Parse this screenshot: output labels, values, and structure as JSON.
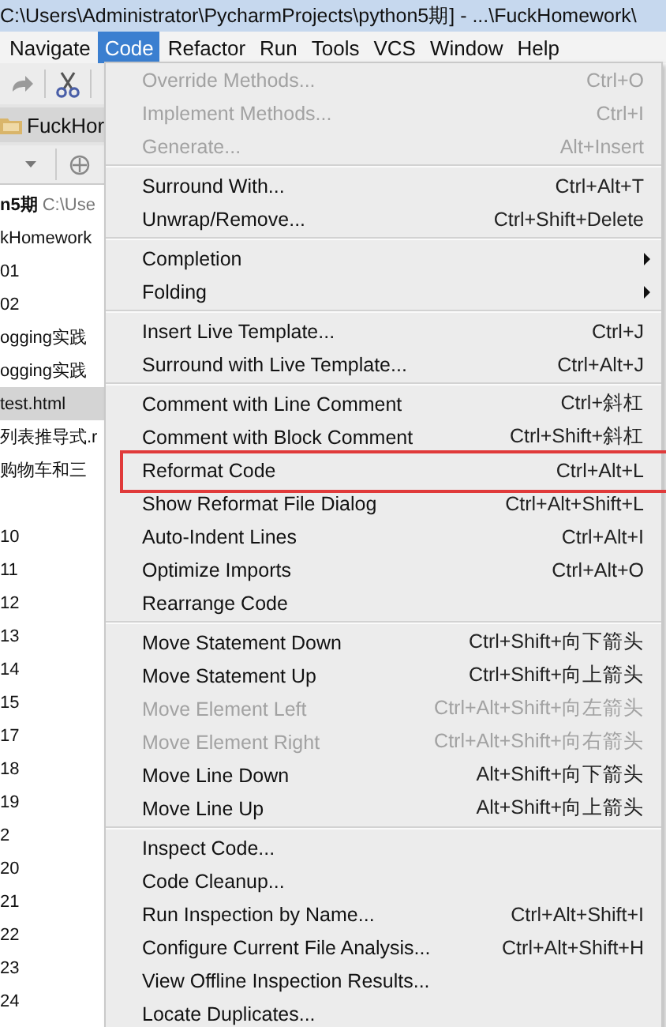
{
  "window": {
    "title": "C:\\Users\\Administrator\\PycharmProjects\\python5期] - ...\\FuckHomework\\"
  },
  "menu_bar": [
    {
      "label": "Navigate",
      "selected": false
    },
    {
      "label": "Code",
      "selected": true
    },
    {
      "label": "Refactor",
      "selected": false
    },
    {
      "label": "Run",
      "selected": false
    },
    {
      "label": "Tools",
      "selected": false
    },
    {
      "label": "VCS",
      "selected": false
    },
    {
      "label": "Window",
      "selected": false
    },
    {
      "label": "Help",
      "selected": false
    }
  ],
  "project_tab": {
    "label": "FuckHor"
  },
  "tree": [
    {
      "kind": "root",
      "label": "n5期",
      "note": "C:\\Use",
      "selected": false
    },
    {
      "kind": "file",
      "label": "kHomework",
      "selected": false
    },
    {
      "kind": "file",
      "label": "01",
      "selected": false
    },
    {
      "kind": "file",
      "label": "02",
      "selected": false
    },
    {
      "kind": "file",
      "label": "ogging实践",
      "selected": false
    },
    {
      "kind": "file",
      "label": "ogging实践",
      "selected": false
    },
    {
      "kind": "file",
      "label": "test.html",
      "selected": true
    },
    {
      "kind": "file",
      "label": "列表推导式.r",
      "selected": false
    },
    {
      "kind": "file",
      "label": "购物车和三",
      "selected": false
    },
    {
      "kind": "spacer"
    },
    {
      "kind": "file",
      "label": "10",
      "selected": false
    },
    {
      "kind": "file",
      "label": "11",
      "selected": false
    },
    {
      "kind": "file",
      "label": "12",
      "selected": false
    },
    {
      "kind": "file",
      "label": "13",
      "selected": false
    },
    {
      "kind": "file",
      "label": "14",
      "selected": false
    },
    {
      "kind": "file",
      "label": "15",
      "selected": false
    },
    {
      "kind": "file",
      "label": "17",
      "selected": false
    },
    {
      "kind": "file",
      "label": "18",
      "selected": false
    },
    {
      "kind": "file",
      "label": "19",
      "selected": false
    },
    {
      "kind": "file",
      "label": "2",
      "selected": false
    },
    {
      "kind": "file",
      "label": "20",
      "selected": false
    },
    {
      "kind": "file",
      "label": "21",
      "selected": false
    },
    {
      "kind": "file",
      "label": "22",
      "selected": false
    },
    {
      "kind": "file",
      "label": "23",
      "selected": false
    },
    {
      "kind": "file",
      "label": "24",
      "selected": false
    }
  ],
  "code_menu": {
    "items": [
      {
        "kind": "item",
        "label": "Override Methods...",
        "shortcut": "Ctrl+O",
        "disabled": true,
        "highlighted": false
      },
      {
        "kind": "item",
        "label": "Implement Methods...",
        "shortcut": "Ctrl+I",
        "disabled": true,
        "highlighted": false
      },
      {
        "kind": "item",
        "label": "Generate...",
        "shortcut": "Alt+Insert",
        "disabled": true,
        "highlighted": false
      },
      {
        "kind": "separator"
      },
      {
        "kind": "item",
        "label": "Surround With...",
        "shortcut": "Ctrl+Alt+T",
        "disabled": false,
        "highlighted": false
      },
      {
        "kind": "item",
        "label": "Unwrap/Remove...",
        "shortcut": "Ctrl+Shift+Delete",
        "disabled": false,
        "highlighted": false
      },
      {
        "kind": "separator"
      },
      {
        "kind": "submenu",
        "label": "Completion",
        "disabled": false,
        "highlighted": false
      },
      {
        "kind": "submenu",
        "label": "Folding",
        "disabled": false,
        "highlighted": false
      },
      {
        "kind": "separator"
      },
      {
        "kind": "item",
        "label": "Insert Live Template...",
        "shortcut": "Ctrl+J",
        "disabled": false,
        "highlighted": false
      },
      {
        "kind": "item",
        "label": "Surround with Live Template...",
        "shortcut": "Ctrl+Alt+J",
        "disabled": false,
        "highlighted": false
      },
      {
        "kind": "separator"
      },
      {
        "kind": "item",
        "label": "Comment with Line Comment",
        "shortcut": "Ctrl+斜杠",
        "disabled": false,
        "highlighted": false
      },
      {
        "kind": "item",
        "label": "Comment with Block Comment",
        "shortcut": "Ctrl+Shift+斜杠",
        "disabled": false,
        "highlighted": false
      },
      {
        "kind": "item",
        "label": "Reformat Code",
        "shortcut": "Ctrl+Alt+L",
        "disabled": false,
        "highlighted": true
      },
      {
        "kind": "item",
        "label": "Show Reformat File Dialog",
        "shortcut": "Ctrl+Alt+Shift+L",
        "disabled": false,
        "highlighted": false
      },
      {
        "kind": "item",
        "label": "Auto-Indent Lines",
        "shortcut": "Ctrl+Alt+I",
        "disabled": false,
        "highlighted": false
      },
      {
        "kind": "item",
        "label": "Optimize Imports",
        "shortcut": "Ctrl+Alt+O",
        "disabled": false,
        "highlighted": false
      },
      {
        "kind": "item",
        "label": "Rearrange Code",
        "disabled": false,
        "highlighted": false
      },
      {
        "kind": "separator"
      },
      {
        "kind": "item",
        "label": "Move Statement Down",
        "shortcut": "Ctrl+Shift+向下箭头",
        "disabled": false,
        "highlighted": false
      },
      {
        "kind": "item",
        "label": "Move Statement Up",
        "shortcut": "Ctrl+Shift+向上箭头",
        "disabled": false,
        "highlighted": false
      },
      {
        "kind": "item",
        "label": "Move Element Left",
        "shortcut": "Ctrl+Alt+Shift+向左箭头",
        "disabled": true,
        "highlighted": false
      },
      {
        "kind": "item",
        "label": "Move Element Right",
        "shortcut": "Ctrl+Alt+Shift+向右箭头",
        "disabled": true,
        "highlighted": false
      },
      {
        "kind": "item",
        "label": "Move Line Down",
        "shortcut": "Alt+Shift+向下箭头",
        "disabled": false,
        "highlighted": false
      },
      {
        "kind": "item",
        "label": "Move Line Up",
        "shortcut": "Alt+Shift+向上箭头",
        "disabled": false,
        "highlighted": false
      },
      {
        "kind": "separator"
      },
      {
        "kind": "item",
        "label": "Inspect Code...",
        "disabled": false,
        "highlighted": false
      },
      {
        "kind": "item",
        "label": "Code Cleanup...",
        "disabled": false,
        "highlighted": false
      },
      {
        "kind": "item",
        "label": "Run Inspection by Name...",
        "shortcut": "Ctrl+Alt+Shift+I",
        "disabled": false,
        "highlighted": false
      },
      {
        "kind": "item",
        "label": "Configure Current File Analysis...",
        "shortcut": "Ctrl+Alt+Shift+H",
        "disabled": false,
        "highlighted": false
      },
      {
        "kind": "item",
        "label": "View Offline Inspection Results...",
        "disabled": false,
        "highlighted": false
      },
      {
        "kind": "item",
        "label": "Locate Duplicates...",
        "disabled": false,
        "highlighted": false
      }
    ]
  }
}
